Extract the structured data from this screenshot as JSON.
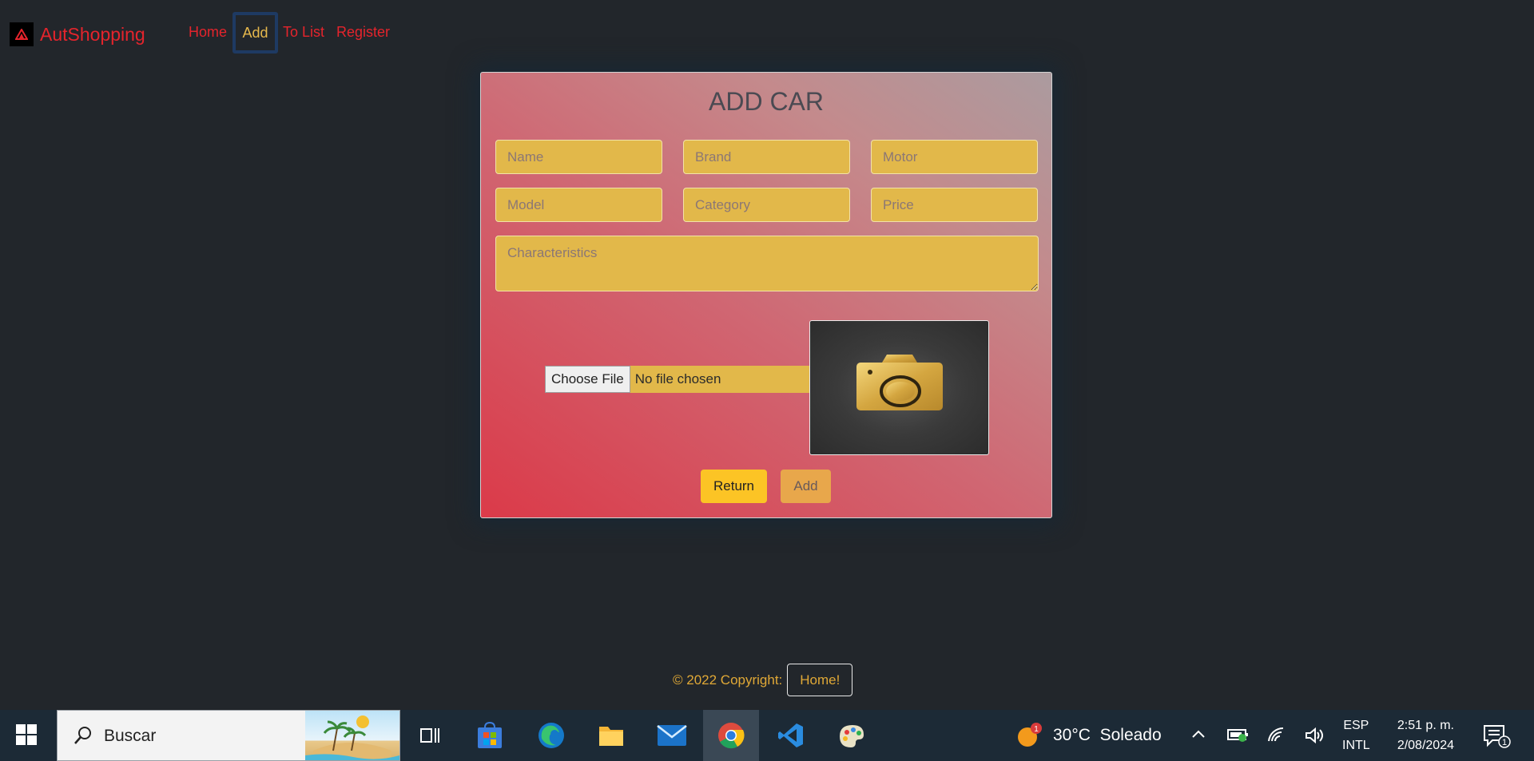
{
  "nav": {
    "brand": "AutShopping",
    "links": [
      "Home",
      "Add",
      "To List",
      "Register"
    ]
  },
  "form": {
    "title": "ADD CAR",
    "placeholders": {
      "name": "Name",
      "brand": "Brand",
      "motor": "Motor",
      "model": "Model",
      "category": "Category",
      "price": "Price",
      "characteristics": "Characteristics"
    },
    "file": {
      "button_label": "Choose File",
      "status": "No file chosen"
    },
    "return_label": "Return",
    "add_label": "Add"
  },
  "footer": {
    "copyright": "© 2022 Copyright:",
    "home_label": "Home!"
  },
  "taskbar": {
    "search_placeholder": "Buscar",
    "weather": "30°C  Soleado",
    "weather_badge": "1",
    "lang_top": "ESP",
    "lang_bottom": "INTL",
    "time": "2:51 p. m.",
    "date": "2/08/2024",
    "notification_count": "1"
  },
  "colors": {
    "background": "#22262b",
    "brand_red": "#e5242c",
    "field_gold": "#e2b84a",
    "return_yellow": "#fcc425",
    "add_orange": "#e8a74b",
    "footer_gold": "#e0a836"
  }
}
